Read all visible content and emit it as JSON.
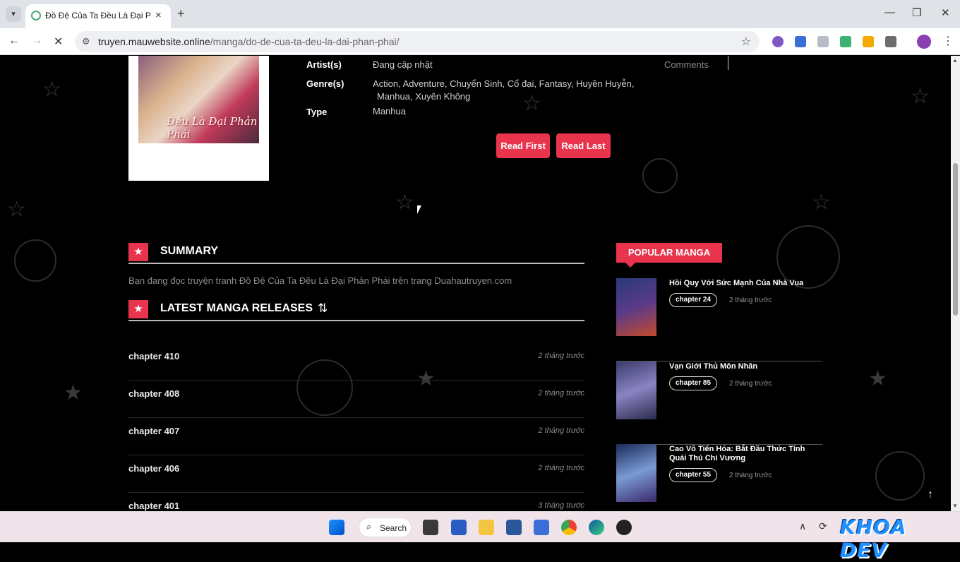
{
  "browser": {
    "tab_title": "Đồ Đệ Của Ta Đều Là Đại Phản",
    "url_domain": "truyen.mauwebsite.online",
    "url_path": "/manga/do-de-cua-ta-deu-la-dai-phan-phai/"
  },
  "cover": {
    "art_text": "Đều Là Đại Phản Phái"
  },
  "info": {
    "artist_label": "Artist(s)",
    "artist_value": "Đang cập nhật",
    "genre_label": "Genre(s)",
    "genres_line1": "Action,  Adventure,  Chuyển Sinh,  Cổ đại,  Fantasy,  Huyền Huyễn,",
    "genres_line2": "Manhua,  Xuyên Không",
    "type_label": "Type",
    "type_value": "Manhua",
    "comments_label": "Comments"
  },
  "buttons": {
    "read_first": "Read First",
    "read_last": "Read Last"
  },
  "summary": {
    "title": "SUMMARY",
    "text": "Bạn đang đọc truyện tranh Đồ Đệ Của Ta Đều Là Đại Phản Phái trên trang Duahautruyen.com"
  },
  "latest": {
    "title": "LATEST MANGA RELEASES",
    "chapters": [
      {
        "name": "chapter 410",
        "time": "2 tháng trước"
      },
      {
        "name": "chapter 408",
        "time": "2 tháng trước"
      },
      {
        "name": "chapter 407",
        "time": "2 tháng trước"
      },
      {
        "name": "chapter 406",
        "time": "2 tháng trước"
      },
      {
        "name": "chapter 401",
        "time": "3 tháng trước"
      }
    ]
  },
  "popular": {
    "title": "POPULAR MANGA",
    "items": [
      {
        "name": "Hồi Quy Với Sức Mạnh Của Nhà Vua",
        "chapter": "chapter 24",
        "time": "2 tháng trước"
      },
      {
        "name": "Vạn Giới Thủ Môn Nhân",
        "chapter": "chapter 85",
        "time": "2 tháng trước"
      },
      {
        "name": "Cao Võ Tiến Hóa: Bắt Đầu Thức Tỉnh Quái Thú Chi Vương",
        "chapter": "chapter 55",
        "time": "2 tháng trước"
      }
    ]
  },
  "taskbar": {
    "search_label": "Search",
    "brand": "KHOA DEV"
  },
  "colors": {
    "accent": "#e8344d",
    "page_bg": "#000000"
  }
}
